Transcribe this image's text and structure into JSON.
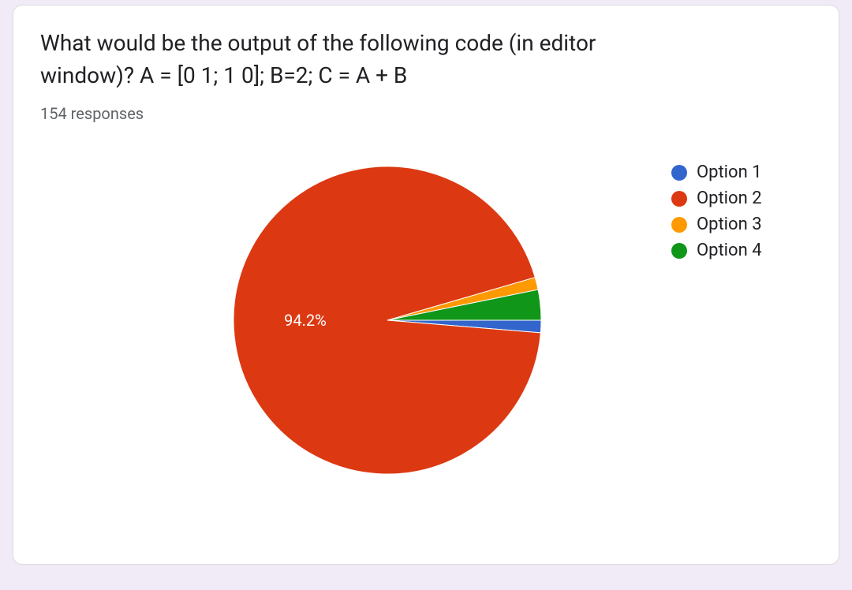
{
  "title": "What would be the output of the following code (in editor window)? A = [0 1; 1 0]; B=2; C = A + B",
  "responses_text": "154 responses",
  "chart_data": {
    "type": "pie",
    "categories": [
      "Option 1",
      "Option 2",
      "Option 3",
      "Option 4"
    ],
    "values": [
      1.3,
      94.2,
      1.3,
      3.2
    ],
    "colors": [
      "#3366cc",
      "#dc3912",
      "#ff9900",
      "#109618"
    ],
    "data_label": "94.2%"
  },
  "legend": [
    {
      "label": "Option 1",
      "color": "#3366cc"
    },
    {
      "label": "Option 2",
      "color": "#dc3912"
    },
    {
      "label": "Option 3",
      "color": "#ff9900"
    },
    {
      "label": "Option 4",
      "color": "#109618"
    }
  ]
}
